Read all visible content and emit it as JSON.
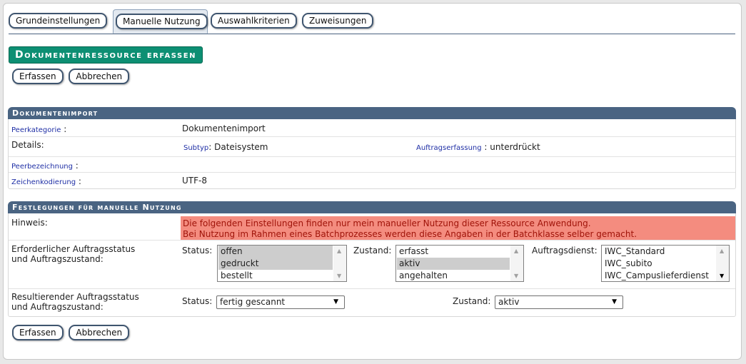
{
  "tabs": [
    {
      "label": "Grundeinstellungen"
    },
    {
      "label": "Manuelle Nutzung"
    },
    {
      "label": "Auswahlkriterien"
    },
    {
      "label": "Zuweisungen"
    }
  ],
  "page_title": "Dokumentenressource erfassen",
  "buttons": {
    "save": "Erfassen",
    "cancel": "Abbrechen"
  },
  "import_section": {
    "title": "Dokumentenimport",
    "peerkategorie_label": "Peerkategorie",
    "peerkategorie_value": "Dokumentenimport",
    "details_label": "Details:",
    "subtyp_label": "Subtyp",
    "subtyp_value": "Dateisystem",
    "auftragserfassung_label": "Auftragserfassung",
    "auftragserfassung_value": "unterdrückt",
    "peerbezeichnung_label": "Peerbezeichnung",
    "peerbezeichnung_value": "",
    "zeichenkodierung_label": "Zeichenkodierung",
    "zeichenkodierung_value": "UTF-8"
  },
  "manual_section": {
    "title": "Festlegungen für manuelle Nutzung",
    "hint_label": "Hinweis:",
    "hint_line1": "Die folgenden Einstellungen finden nur mein manueller Nutzung dieser Ressource Anwendung.",
    "hint_line2": "Bei Nutzung im Rahmen eines Batchprozesses werden diese Angaben in der Batchklasse selber gemacht.",
    "required_label_1": "Erforderlicher Auftragsstatus",
    "required_label_2": "und Auftragszustand:",
    "status_label": "Status:",
    "status_options": [
      "offen",
      "gedruckt",
      "bestellt"
    ],
    "zustand_label": "Zustand:",
    "zustand_options": [
      "erfasst",
      "aktiv",
      "angehalten"
    ],
    "auftragsdienst_label": "Auftragsdienst:",
    "auftragsdienst_options": [
      "IWC_Standard",
      "IWC_subito",
      "IWC_Campuslieferdienst"
    ],
    "result_label_1": "Resultierender Auftragsstatus",
    "result_label_2": "und Auftragszustand:",
    "result_status_label": "Status:",
    "result_status_value": "fertig gescannt",
    "result_zustand_label": "Zustand:",
    "result_zustand_value": "aktiv"
  },
  "colors": {
    "accent": "#0d8f73",
    "section_header": "#4a6482",
    "hint_bg": "#f48c7f",
    "hint_text": "#a0140a",
    "link": "#1f2fa5"
  }
}
